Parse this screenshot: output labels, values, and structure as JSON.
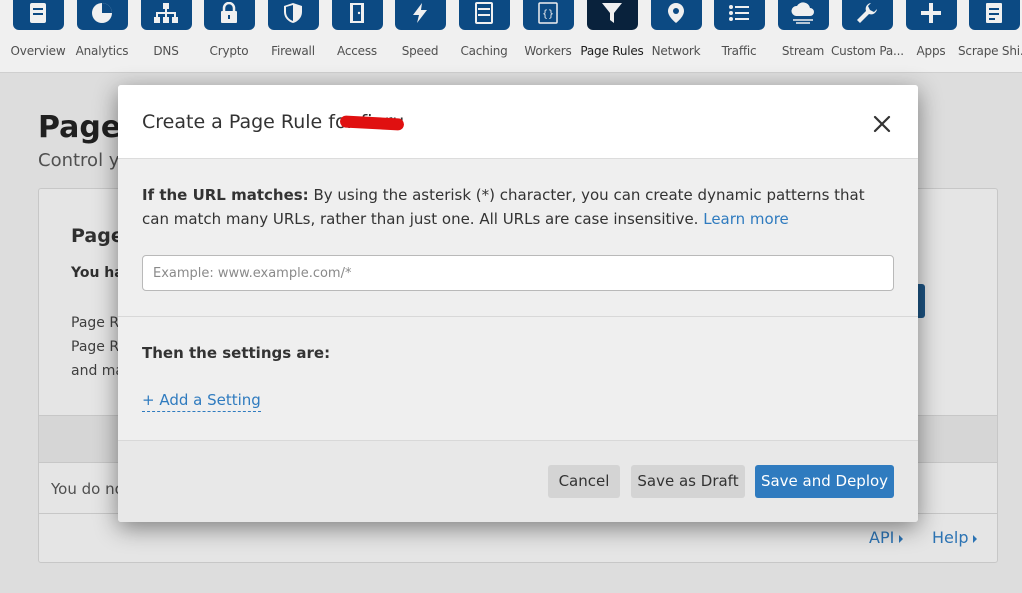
{
  "nav": {
    "items": [
      {
        "label": "Overview",
        "icon": "overview-icon"
      },
      {
        "label": "Analytics",
        "icon": "analytics-icon"
      },
      {
        "label": "DNS",
        "icon": "dns-icon"
      },
      {
        "label": "Crypto",
        "icon": "lock-icon"
      },
      {
        "label": "Firewall",
        "icon": "shield-icon"
      },
      {
        "label": "Access",
        "icon": "door-icon"
      },
      {
        "label": "Speed",
        "icon": "lightning-icon"
      },
      {
        "label": "Caching",
        "icon": "server-icon"
      },
      {
        "label": "Workers",
        "icon": "code-braces-icon"
      },
      {
        "label": "Page Rules",
        "icon": "filter-icon",
        "active": true
      },
      {
        "label": "Network",
        "icon": "location-pin-icon"
      },
      {
        "label": "Traffic",
        "icon": "list-icon"
      },
      {
        "label": "Stream",
        "icon": "cloud-stream-icon"
      },
      {
        "label": "Custom Pa...",
        "icon": "wrench-icon"
      },
      {
        "label": "Apps",
        "icon": "plus-icon"
      },
      {
        "label": "Scrape Shi...",
        "icon": "document-icon"
      }
    ]
  },
  "background": {
    "page_title": "Page",
    "page_subtitle": "Control y",
    "card_title": "Page",
    "card_bold": "You ha",
    "card_lines": [
      "Page R",
      "Page R",
      "and ma"
    ],
    "empty_text": "You do no",
    "api_link": "API",
    "help_link": "Help"
  },
  "modal": {
    "title": "Create a Page Rule for fi        .ru",
    "url_label": "If the URL matches:",
    "url_description": "By using the asterisk (*) character, you can create dynamic patterns that can match many URLs, rather than just one. All URLs are case insensitive.",
    "learn_more": "Learn more",
    "url_value": "",
    "url_placeholder": "Example: www.example.com/*",
    "settings_title": "Then the settings are:",
    "add_setting": "+ Add a Setting",
    "cancel": "Cancel",
    "save_draft": "Save as Draft",
    "save_deploy": "Save and Deploy"
  },
  "colors": {
    "nav_icon": "#0d4f8c",
    "nav_icon_active": "#0a2540",
    "link": "#2f7bbf",
    "primary_button": "#2f7bbf",
    "redaction": "#e01010"
  }
}
